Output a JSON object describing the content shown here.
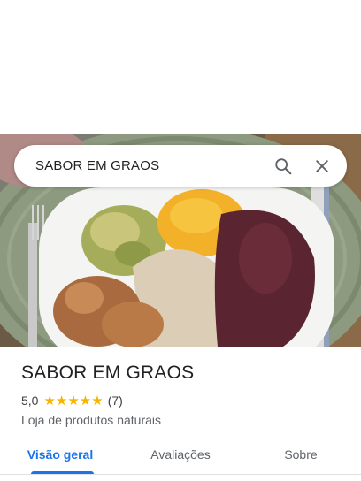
{
  "search": {
    "value": "SABOR EM GRAOS"
  },
  "place": {
    "title": "SABOR EM GRAOS",
    "rating": "5,0",
    "stars": "★★★★★",
    "review_count": "(7)",
    "category": "Loja de produtos naturais"
  },
  "tabs": [
    {
      "label": "Visão geral",
      "active": true
    },
    {
      "label": "Avaliações",
      "active": false
    },
    {
      "label": "Sobre",
      "active": false
    }
  ],
  "colors": {
    "accent": "#1a73e8",
    "star": "#f4b400"
  }
}
